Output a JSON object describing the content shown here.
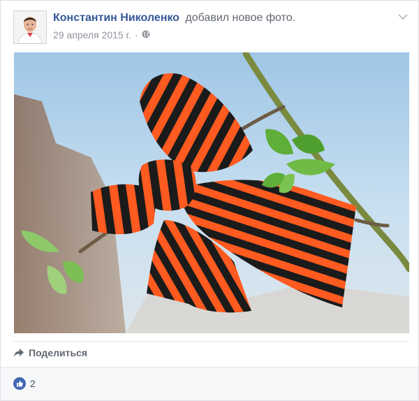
{
  "post": {
    "author": "Константин Николенко",
    "action": "добавил новое фото.",
    "date": "29 апреля 2015 г.",
    "separator": "·",
    "privacy_icon": "globe-icon",
    "menu_icon": "chevron-down-icon"
  },
  "photo": {
    "ribbon_colors": [
      "#ff5a1f",
      "#1b1b1b"
    ],
    "sky_color": "#c8dff0"
  },
  "actions": {
    "share_label": "Поделиться",
    "share_icon": "share-arrow-icon"
  },
  "reactions": {
    "like_icon": "thumbs-up-icon",
    "count": "2",
    "accent": "#4267b2"
  }
}
